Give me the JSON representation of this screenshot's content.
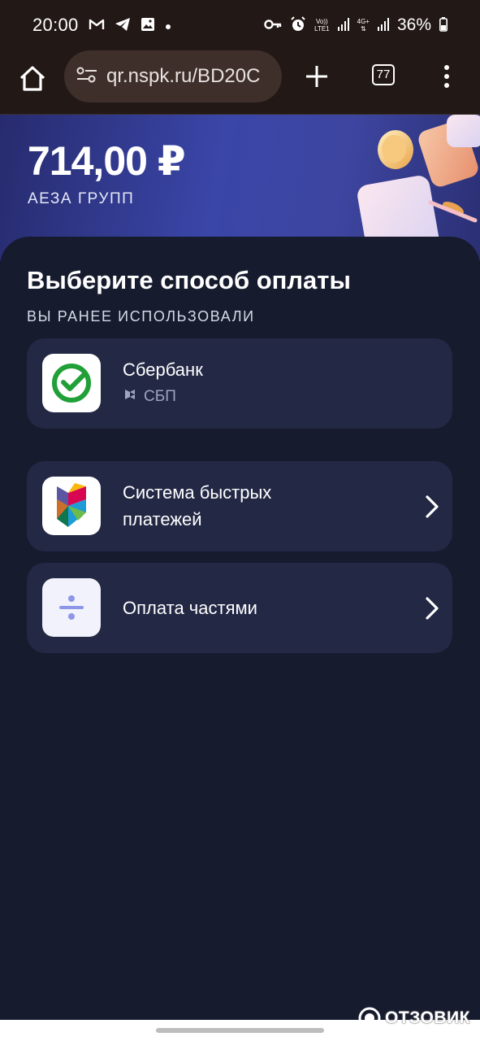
{
  "status_bar": {
    "time": "20:00",
    "icons": [
      "gmail-icon",
      "telegram-icon",
      "gallery-icon",
      "dot-icon"
    ],
    "volte": "Vo))",
    "lte": "LTE1",
    "network": "4G+",
    "battery": "36%"
  },
  "browser": {
    "url": "qr.nspk.ru/BD20C",
    "tabs_count": "77"
  },
  "payment": {
    "amount": "714,00 ₽",
    "merchant": "АЕЗА ГРУПП"
  },
  "method_section": {
    "title": "Выберите способ оплаты",
    "previously_used_label": "ВЫ РАНЕЕ ИСПОЛЬЗОВАЛИ",
    "previous": {
      "name": "Сбербанк",
      "method": "СБП"
    },
    "options": [
      {
        "name": "Система быстрых платежей",
        "line1": "Система быстрых",
        "line2": "платежей"
      },
      {
        "name": "Оплата частями"
      }
    ]
  },
  "watermark": "ОТЗОВИК",
  "colors": {
    "background": "#161b2e",
    "card": "#232845",
    "hero_gradient_from": "#272b6e",
    "hero_gradient_to": "#3a46a8",
    "sber_green": "#21a038",
    "browser_bar": "#221816"
  }
}
